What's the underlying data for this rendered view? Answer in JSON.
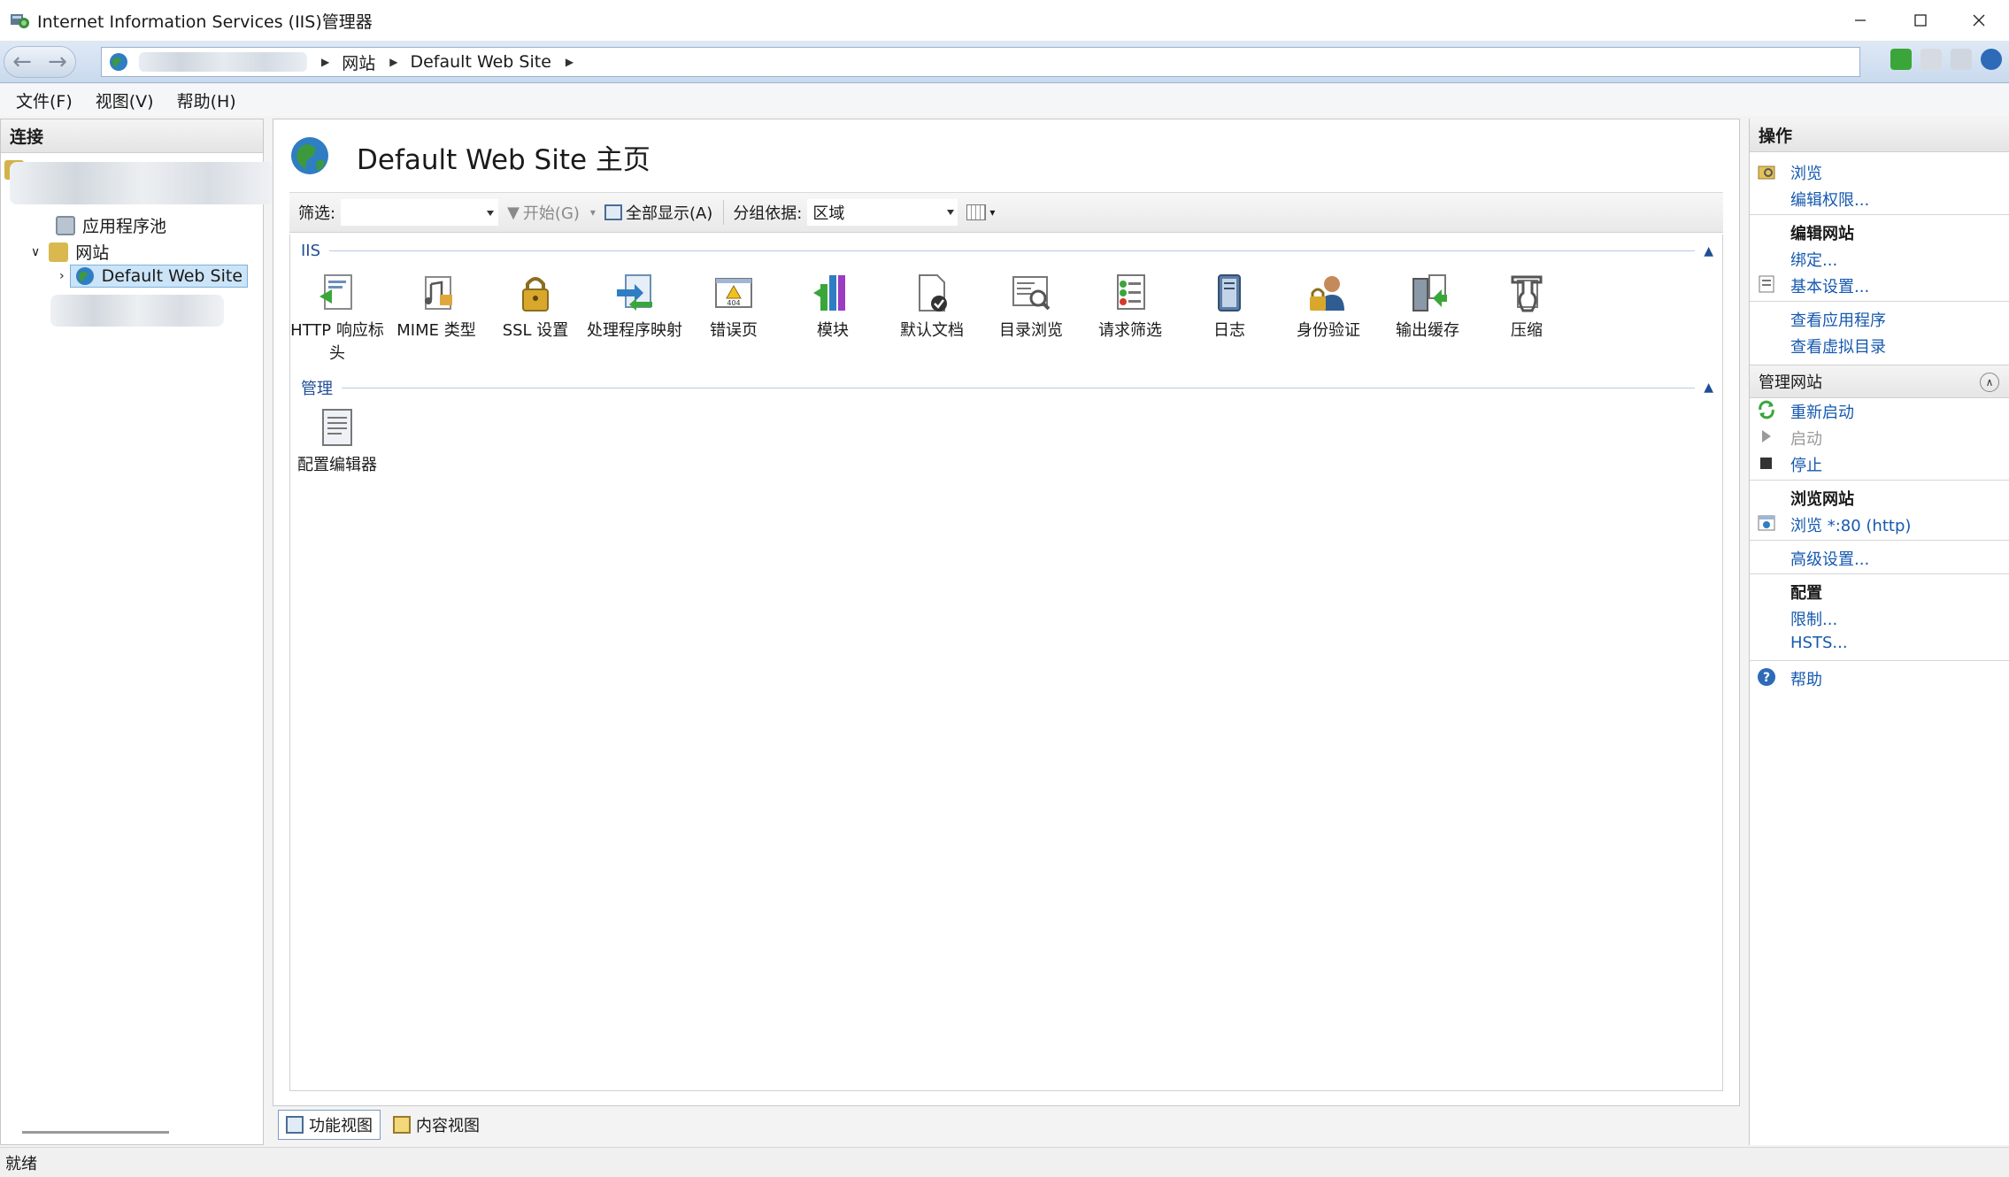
{
  "window": {
    "title": "Internet Information Services (IIS)管理器",
    "minimize_icon": "minimize-icon",
    "maximize_icon": "maximize-icon",
    "close_icon": "close-icon"
  },
  "address": {
    "crumbs": [
      "网站",
      "Default Web Site"
    ]
  },
  "menu": {
    "file": "文件(F)",
    "view": "视图(V)",
    "help": "帮助(H)"
  },
  "connections": {
    "header": "连接",
    "app_pools": "应用程序池",
    "sites": "网站",
    "default_site": "Default Web Site"
  },
  "main": {
    "title": "Default Web Site 主页",
    "filter_label": "筛选:",
    "go_label": "开始(G)",
    "show_all_label": "全部显示(A)",
    "group_by_label": "分组依据:",
    "group_by_value": "区域",
    "groups": [
      {
        "name": "IIS",
        "features": [
          {
            "label": "HTTP 响应标头",
            "icon": "http-headers-icon"
          },
          {
            "label": "MIME 类型",
            "icon": "mime-types-icon"
          },
          {
            "label": "SSL 设置",
            "icon": "ssl-lock-icon"
          },
          {
            "label": "处理程序映射",
            "icon": "handler-mappings-icon"
          },
          {
            "label": "错误页",
            "icon": "error-pages-icon"
          },
          {
            "label": "模块",
            "icon": "modules-icon"
          },
          {
            "label": "默认文档",
            "icon": "default-document-icon"
          },
          {
            "label": "目录浏览",
            "icon": "directory-browsing-icon"
          },
          {
            "label": "请求筛选",
            "icon": "request-filtering-icon"
          },
          {
            "label": "日志",
            "icon": "logging-icon"
          },
          {
            "label": "身份验证",
            "icon": "authentication-icon"
          },
          {
            "label": "输出缓存",
            "icon": "output-caching-icon"
          },
          {
            "label": "压缩",
            "icon": "compression-icon"
          }
        ]
      },
      {
        "name": "管理",
        "features": [
          {
            "label": "配置编辑器",
            "icon": "config-editor-icon"
          }
        ]
      }
    ]
  },
  "view_tabs": {
    "features": "功能视图",
    "content": "内容视图"
  },
  "actions": {
    "header": "操作",
    "browse": "浏览",
    "edit_permissions": "编辑权限...",
    "edit_site_head": "编辑网站",
    "bindings": "绑定...",
    "basic_settings": "基本设置...",
    "view_applications": "查看应用程序",
    "view_virtual_dirs": "查看虚拟目录",
    "manage_site_head": "管理网站",
    "restart": "重新启动",
    "start": "启动",
    "stop": "停止",
    "browse_site_head": "浏览网站",
    "browse_port": "浏览 *:80 (http)",
    "advanced_settings": "高级设置...",
    "config_head": "配置",
    "limits": "限制...",
    "hsts": "HSTS...",
    "help": "帮助"
  },
  "status": {
    "text": "就绪"
  },
  "colors": {
    "link": "#1659b0",
    "group_header": "#1f4e96",
    "selection": "#cce4f7"
  }
}
